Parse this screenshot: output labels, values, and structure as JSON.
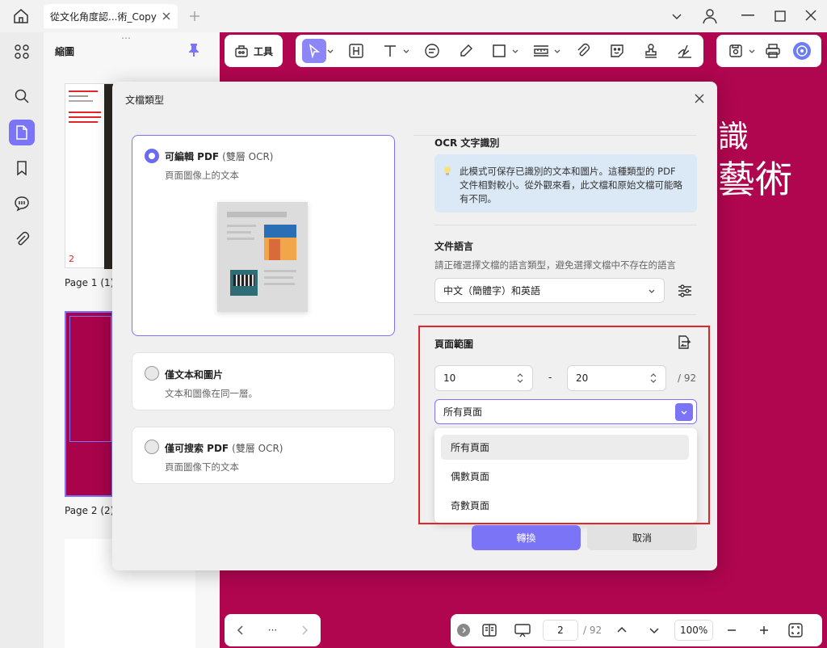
{
  "tab": {
    "title": "從文化角度認...術_Copy"
  },
  "panel": {
    "title": "縮圖",
    "page1": "Page 1 (1)",
    "page2": "Page 2 (2)"
  },
  "toolbar": {
    "tools_label": "工具"
  },
  "doc": {
    "text1": "識",
    "text2": "藝術"
  },
  "modal": {
    "title": "文檔類型",
    "options": [
      {
        "title": "可編輯 PDF",
        "suffix": "(雙層 OCR)",
        "desc": "頁面圖像上的文本",
        "selected": true
      },
      {
        "title": "僅文本和圖片",
        "suffix": "",
        "desc": "文本和圖像在同一層。",
        "selected": false
      },
      {
        "title": "僅可搜索 PDF",
        "suffix": "(雙層 OCR)",
        "desc": "頁面圖像下的文本",
        "selected": false
      }
    ],
    "ocr": {
      "heading": "OCR 文字識別",
      "info": "此模式可保存已識別的文本和圖片。這種類型的 PDF 文件相對較小。從外觀來看，此文檔和原始文檔可能略有不同。"
    },
    "language": {
      "heading": "文件語言",
      "desc": "請正確選擇文檔的語言類型，避免選擇文檔中不存在的語言",
      "value": "中文（簡體字）和英語"
    },
    "range": {
      "heading": "頁面範圍",
      "from": "10",
      "to": "20",
      "dash": "-",
      "total": "/ 92",
      "selected": "所有頁面",
      "options": [
        "所有頁面",
        "偶數頁面",
        "奇數頁面"
      ]
    },
    "convert_label": "轉換",
    "cancel_label": "取消"
  },
  "bottom": {
    "ellipsis": "···",
    "page": "2",
    "total": "/ 92",
    "zoom": "100%"
  },
  "colors": {
    "accent": "#7b74f7",
    "document_bg": "#b0064f",
    "highlight": "#e0262a"
  }
}
